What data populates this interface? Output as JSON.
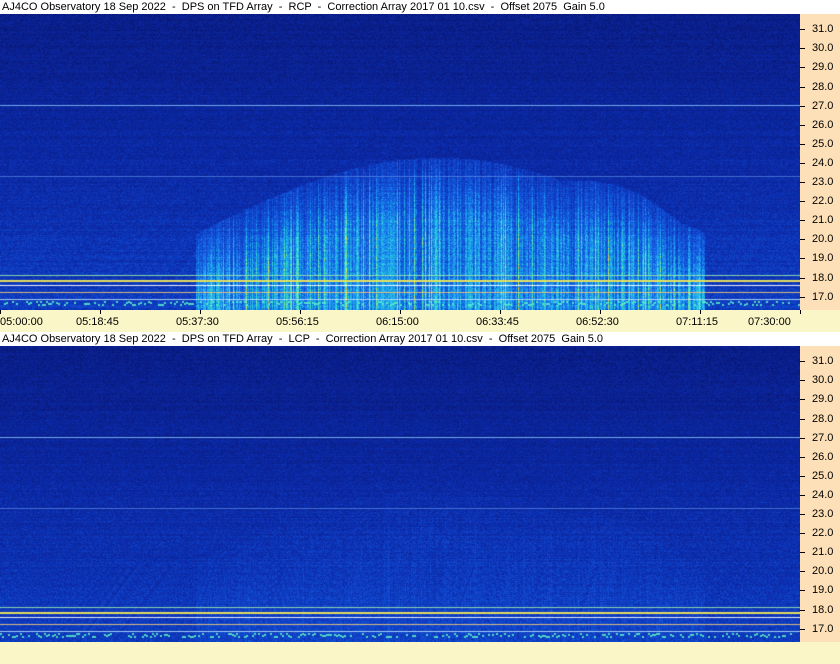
{
  "colors": {
    "background": "#0c2aa6",
    "y_axis_bg": "#fde0b8",
    "x_axis_bg": "#fbf6c8"
  },
  "panels": [
    {
      "title": "AJ4CO Observatory 18 Sep 2022  -  DPS on TFD Array  -  RCP  -  Correction Array 2017 01 10.csv  -  Offset 2075  Gain 5.0"
    },
    {
      "title": "AJ4CO Observatory 18 Sep 2022  -  DPS on TFD Array  -  LCP  -  Correction Array 2017 01 10.csv  -  Offset 2075  Gain 5.0"
    }
  ],
  "chart_data": [
    {
      "type": "heatmap",
      "title": "AJ4CO Observatory 18 Sep 2022  -  DPS on TFD Array  -  RCP  -  Correction Array 2017 01 10.csv  -  Offset 2075  Gain 5.0",
      "polarization": "RCP",
      "x_ticks": [
        "05:00:00",
        "05:18:45",
        "05:37:30",
        "05:56:15",
        "06:15:00",
        "06:33:45",
        "06:52:30",
        "07:11:15",
        "07:30:00"
      ],
      "x_range": [
        "05:00:00",
        "07:30:00"
      ],
      "y_ticks": [
        "31.0",
        "30.0",
        "29.0",
        "28.0",
        "27.0",
        "26.0",
        "25.0",
        "24.0",
        "23.0",
        "22.0",
        "21.0",
        "20.0",
        "19.0",
        "18.0",
        "17.0"
      ],
      "y_range": [
        16.3,
        31.8
      ],
      "features": {
        "burst_start": "05:37:30",
        "burst_end": "07:11:15",
        "burst_peak_frequency": 25.3,
        "burst_peak_time": "06:39:00"
      }
    },
    {
      "type": "heatmap",
      "title": "AJ4CO Observatory 18 Sep 2022  -  DPS on TFD Array  -  LCP  -  Correction Array 2017 01 10.csv  -  Offset 2075  Gain 5.0",
      "polarization": "LCP",
      "x_ticks": [],
      "y_ticks": [
        "31.0",
        "30.0",
        "29.0",
        "28.0",
        "27.0",
        "26.0",
        "25.0",
        "24.0",
        "23.0",
        "22.0",
        "21.0",
        "20.0",
        "19.0",
        "18.0",
        "17.0"
      ],
      "y_range": [
        16.3,
        31.8
      ]
    }
  ]
}
